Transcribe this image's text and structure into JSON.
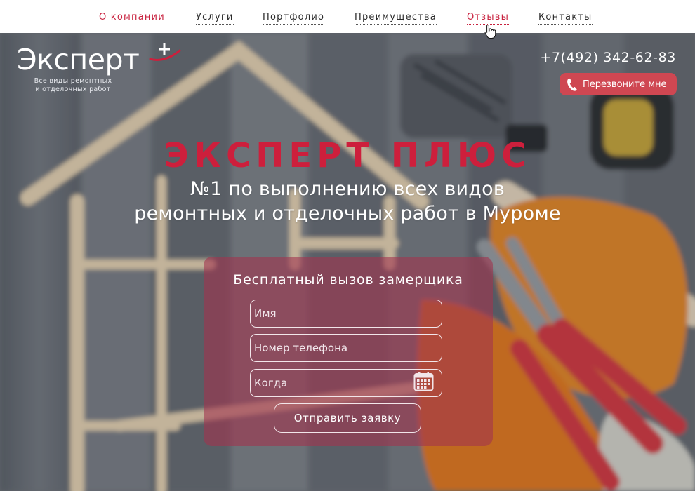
{
  "nav": {
    "items": [
      {
        "label": "О компании",
        "state": "active"
      },
      {
        "label": "Услуги",
        "state": "normal"
      },
      {
        "label": "Портфолио",
        "state": "normal"
      },
      {
        "label": "Преимущества",
        "state": "normal"
      },
      {
        "label": "Отзывы",
        "state": "hover"
      },
      {
        "label": "Контакты",
        "state": "normal"
      }
    ]
  },
  "logo": {
    "name": "Эксперт",
    "tagline_line1": "Все виды ремонтных",
    "tagline_line2": "и отделочных работ"
  },
  "contact": {
    "phone": "+7(492) 342-62-83",
    "callback_label": "Перезвоните мне"
  },
  "hero": {
    "brand": "ЭКСПЕРТ ПЛЮС",
    "subtitle_line1": "№1 по выполнению всех видов",
    "subtitle_line2": "ремонтных и отделочных работ в Муроме"
  },
  "form": {
    "title": "Бесплатный вызов замерщика",
    "name_placeholder": "Имя",
    "phone_placeholder": "Номер телефона",
    "date_placeholder": "Когда",
    "submit_label": "Отправить заявку"
  },
  "colors": {
    "accent": "#cd1f3c",
    "callback_bg": "#cf4752",
    "form_panel": "#a2344e"
  },
  "icons": [
    "phone-icon",
    "calendar-icon",
    "plus-icon",
    "hand-cursor-icon"
  ]
}
